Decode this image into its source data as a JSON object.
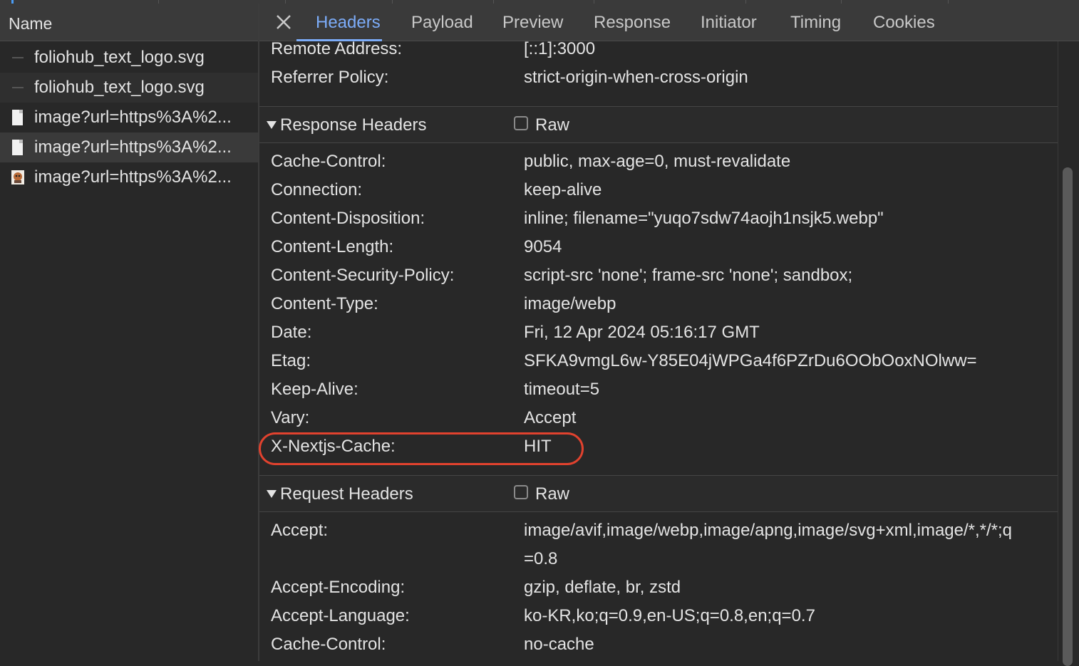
{
  "left_pane": {
    "column_header": "Name",
    "files": [
      {
        "name": "foliohub_text_logo.svg",
        "icon": "svg-logo-icon"
      },
      {
        "name": "foliohub_text_logo.svg",
        "icon": "svg-logo-icon"
      },
      {
        "name": "image?url=https%3A%2...",
        "icon": "blank-image-icon"
      },
      {
        "name": "image?url=https%3A%2...",
        "icon": "blank-image-icon"
      },
      {
        "name": "image?url=https%3A%2...",
        "icon": "thumbnail-image-icon"
      }
    ]
  },
  "tabs": {
    "close_icon": "close-icon",
    "items": [
      "Headers",
      "Payload",
      "Preview",
      "Response",
      "Initiator",
      "Timing",
      "Cookies"
    ],
    "active": "Headers"
  },
  "general": [
    {
      "key": "Remote Address:",
      "value": "[::1]:3000"
    },
    {
      "key": "Referrer Policy:",
      "value": "strict-origin-when-cross-origin"
    }
  ],
  "response_headers": {
    "title": "Response Headers",
    "raw_label": "Raw",
    "rows": [
      {
        "key": "Cache-Control:",
        "value": "public, max-age=0, must-revalidate"
      },
      {
        "key": "Connection:",
        "value": "keep-alive"
      },
      {
        "key": "Content-Disposition:",
        "value": "inline; filename=\"yuqo7sdw74aojh1nsjk5.webp\""
      },
      {
        "key": "Content-Length:",
        "value": "9054"
      },
      {
        "key": "Content-Security-Policy:",
        "value": "script-src 'none'; frame-src 'none'; sandbox;"
      },
      {
        "key": "Content-Type:",
        "value": "image/webp"
      },
      {
        "key": "Date:",
        "value": "Fri, 12 Apr 2024 05:16:17 GMT"
      },
      {
        "key": "Etag:",
        "value": "SFKA9vmgL6w-Y85E04jWPGa4f6PZrDu6OObOoxNOlww="
      },
      {
        "key": "Keep-Alive:",
        "value": "timeout=5"
      },
      {
        "key": "Vary:",
        "value": "Accept"
      },
      {
        "key": "X-Nextjs-Cache:",
        "value": "HIT"
      }
    ]
  },
  "request_headers": {
    "title": "Request Headers",
    "raw_label": "Raw",
    "rows": [
      {
        "key": "Accept:",
        "value": "image/avif,image/webp,image/apng,image/svg+xml,image/*,*/*;q",
        "value_cont": "=0.8"
      },
      {
        "key": "Accept-Encoding:",
        "value": "gzip, deflate, br, zstd"
      },
      {
        "key": "Accept-Language:",
        "value": "ko-KR,ko;q=0.9,en-US;q=0.8,en;q=0.7"
      },
      {
        "key": "Cache-Control:",
        "value": "no-cache"
      }
    ]
  },
  "colors": {
    "accent": "#7cacf8",
    "highlight": "#e1422e",
    "background": "#282828"
  }
}
